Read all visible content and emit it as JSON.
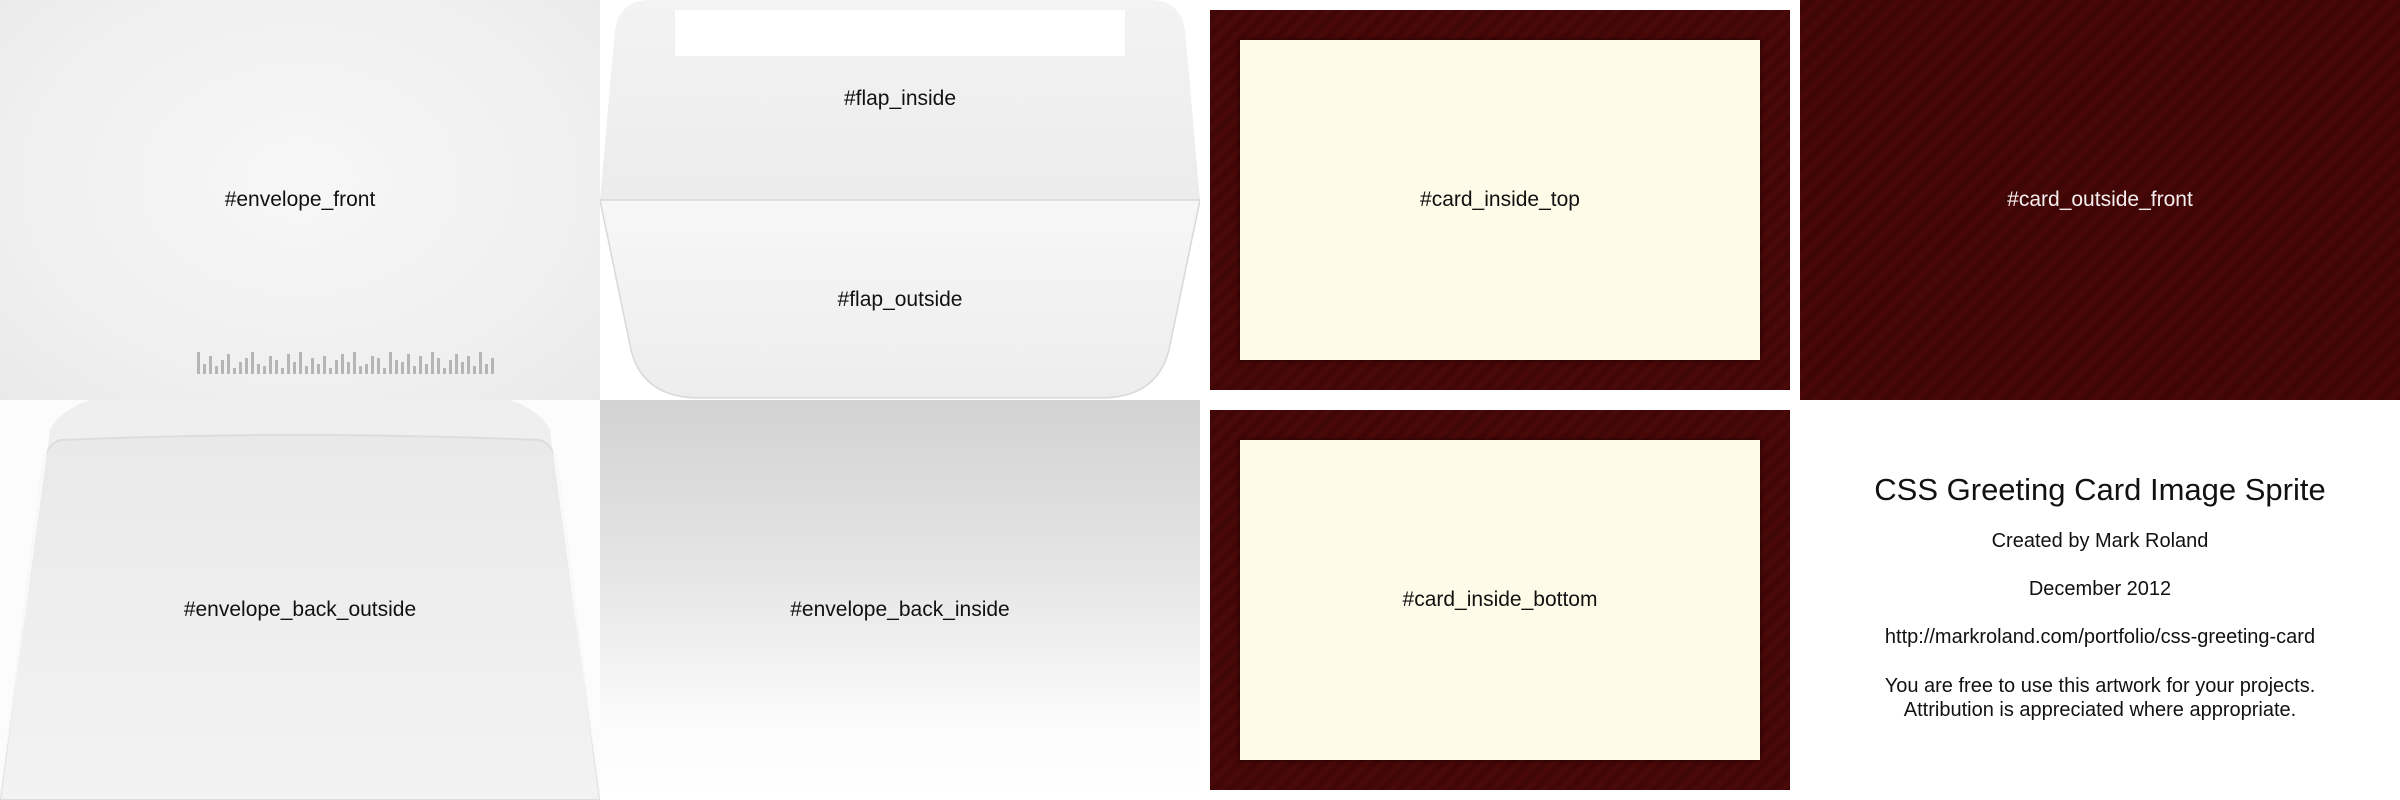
{
  "labels": {
    "envelope_front": "#envelope_front",
    "flap_inside": "#flap_inside",
    "flap_outside": "#flap_outside",
    "card_inside_top": "#card_inside_top",
    "card_outside_front": "#card_outside_front",
    "envelope_back_outside": "#envelope_back_outside",
    "envelope_back_inside": "#envelope_back_inside",
    "card_inside_bottom": "#card_inside_bottom"
  },
  "credits": {
    "title": "CSS Greeting Card Image Sprite",
    "author": "Created by Mark Roland",
    "date": "December 2012",
    "url": "http://markroland.com/portfolio/css-greeting-card",
    "license_line1": "You are free to use this artwork for your projects.",
    "license_line2": "Attribution is appreciated where appropriate."
  },
  "colors": {
    "card_border": "#4a0909",
    "card_paper": "#fefbe8",
    "envelope": "#efefef"
  }
}
